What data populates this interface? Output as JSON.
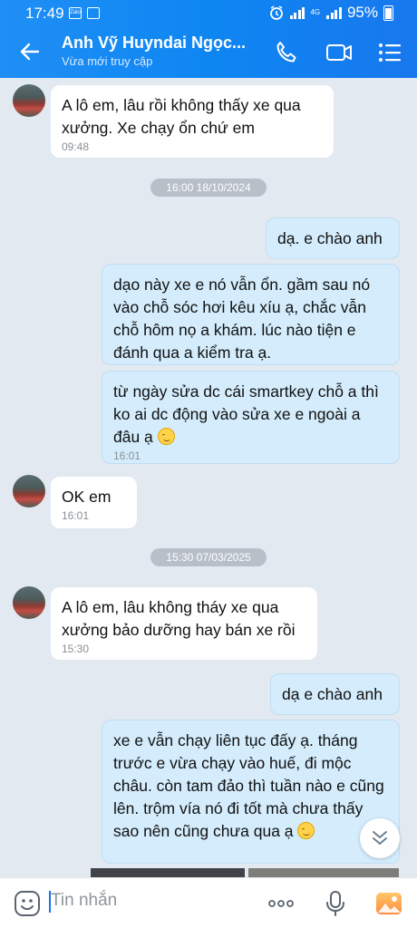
{
  "status_bar": {
    "time": "17:49",
    "battery": "95%",
    "network": "4G"
  },
  "header": {
    "contact_name": "Anh Vỹ Huyndai Ngọc...",
    "presence": "Vừa mới truy cập"
  },
  "messages": [
    {
      "side": "in",
      "text": "A lô em, lâu rồi không thấy xe qua xưởng. Xe chạy ổn chứ em",
      "time": "09:48"
    },
    {
      "type": "date",
      "text": "16:00 18/10/2024"
    },
    {
      "side": "out",
      "text": "dạ. e chào anh"
    },
    {
      "side": "out",
      "text": "dạo này xe e nó vẫn ổn. gầm sau nó vào chỗ sóc hơi kêu xíu ạ, chắc vẫn chỗ hôm nọ a khám. lúc nào tiện e đánh qua a kiểm tra ạ."
    },
    {
      "side": "out",
      "text": "từ ngày sửa dc cái smartkey chỗ a thì ko ai dc động vào sửa xe e ngoài a đâu ạ",
      "time": "16:01"
    },
    {
      "side": "in",
      "text": "OK em",
      "time": "16:01"
    },
    {
      "type": "date",
      "text": "15:30 07/03/2025"
    },
    {
      "side": "in",
      "text": "A lô em, lâu không tháy xe qua xưởng bảo dưỡng hay bán xe rồi",
      "time": "15:30"
    },
    {
      "side": "out",
      "text": "dạ e chào anh"
    },
    {
      "side": "out",
      "text": "xe e vẫn chạy liên tục đấy ạ. tháng trước e vừa chạy vào huế, đi mộc châu. còn tam đảo thì tuần nào e cũng lên. trộm vía nó đi tốt mà chưa thấy sao nên cũng chưa qua ạ"
    }
  ],
  "input": {
    "placeholder": "Tin nhắn"
  },
  "colors": {
    "header": "#0e86f2",
    "incoming": "#ffffff",
    "outgoing": "#d4ecfc",
    "chat_bg": "#e2e9f1"
  }
}
